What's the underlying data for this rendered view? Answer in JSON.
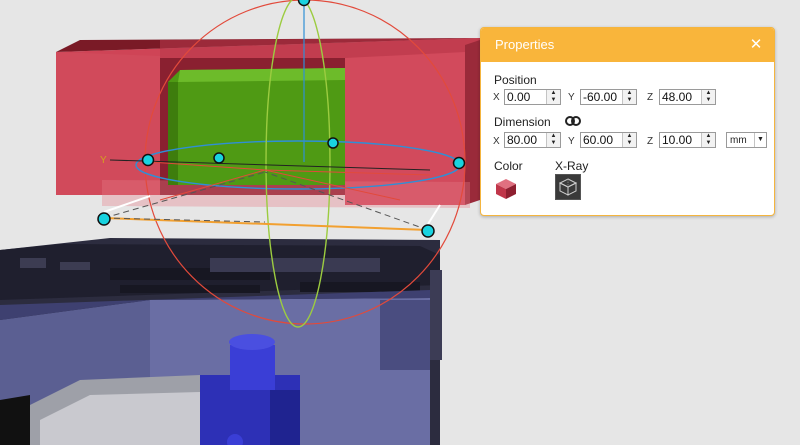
{
  "panel": {
    "title": "Properties",
    "close_icon": "close-icon",
    "position": {
      "label": "Position",
      "x_label": "X",
      "x_value": "0.00",
      "y_label": "Y",
      "y_value": "-60.00",
      "z_label": "Z",
      "z_value": "48.00"
    },
    "dimension": {
      "label": "Dimension",
      "link_icon": "link-icon",
      "x_label": "X",
      "x_value": "80.00",
      "y_label": "Y",
      "y_value": "60.00",
      "z_label": "Z",
      "z_value": "10.00",
      "unit": "mm"
    },
    "color": {
      "label": "Color",
      "value": "#c0364a"
    },
    "xray": {
      "label": "X-Ray",
      "icon": "xray-cube-icon"
    }
  },
  "viewport": {
    "axis_label": "Y",
    "colors": {
      "background": "#e6e6e6",
      "selected_box": "#d2475a",
      "inner_object": "#5aa81a",
      "gizmo_red": "#e24a3b",
      "gizmo_green": "#9ccc40",
      "gizmo_blue": "#2f8fd6",
      "handle": "#19d3e0",
      "base_model": "#2a2a3d",
      "base_side": "#5b5f92"
    }
  }
}
